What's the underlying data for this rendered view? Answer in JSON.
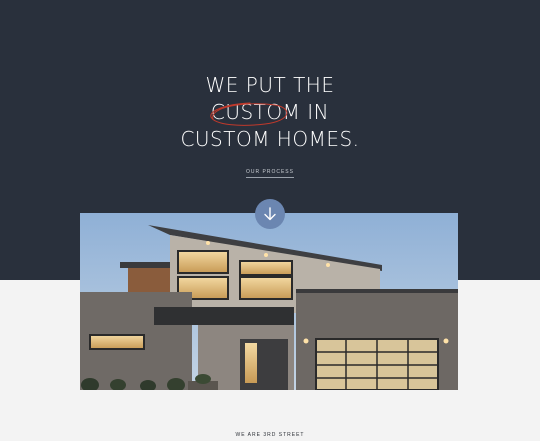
{
  "hero": {
    "headline_line1": "WE PUT THE",
    "headline_custom": "CUSTOM",
    "headline_in": " IN",
    "headline_line3": "CUSTOM HOMES.",
    "cta_label": "OUR PROCESS"
  },
  "icons": {
    "scroll": "arrow-down-icon"
  },
  "next_section": {
    "label": "WE ARE 3RD STREET"
  },
  "colors": {
    "hero_bg": "#29303c",
    "page_bg": "#f3f3f3",
    "accent_button": "#6b86b1",
    "circle_mark": "#c0392b"
  }
}
